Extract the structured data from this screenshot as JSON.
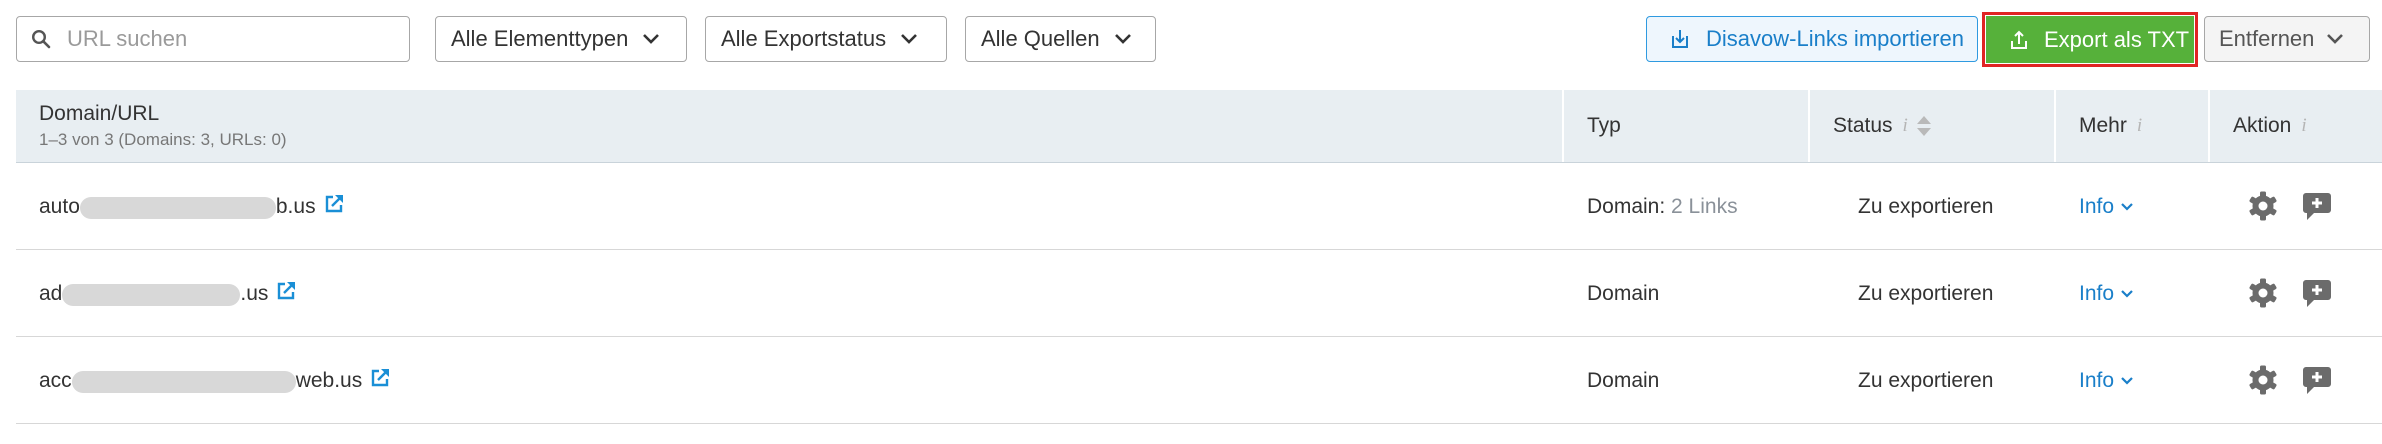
{
  "toolbar": {
    "search": {
      "placeholder": "URL suchen",
      "value": ""
    },
    "filters": [
      {
        "label": "Alle Elementtypen"
      },
      {
        "label": "Alle Exportstatus"
      },
      {
        "label": "Alle Quellen"
      }
    ],
    "import_label": "Disavow-Links importieren",
    "export_label": "Export als TXT",
    "remove_label": "Entfernen"
  },
  "table": {
    "headers": {
      "domain": "Domain/URL",
      "domain_sub": "1–3 von 3 (Domains: 3, URLs: 0)",
      "type": "Typ",
      "status": "Status",
      "more": "Mehr",
      "action": "Aktion",
      "info_glyph": "i"
    },
    "rows": [
      {
        "domain_start": "auto",
        "domain_end": "b.us",
        "type": "Domain:",
        "type_extra": "2 Links",
        "status": "Zu exportieren",
        "more": "Info"
      },
      {
        "domain_start": "ad",
        "domain_end": ".us",
        "type": "Domain",
        "type_extra": "",
        "status": "Zu exportieren",
        "more": "Info"
      },
      {
        "domain_start": "acc",
        "domain_end": "web.us",
        "type": "Domain",
        "type_extra": "",
        "status": "Zu exportieren",
        "more": "Info"
      }
    ]
  },
  "colors": {
    "accent_blue": "#1a7fc9",
    "export_green": "#56b13a",
    "highlight_red": "#e02424",
    "header_bg": "#e8eef2"
  },
  "icons": [
    "search-icon",
    "chevron-down-icon",
    "import-icon",
    "export-upload-icon",
    "external-link-icon",
    "info-icon",
    "sort-icon",
    "gear-icon",
    "comment-plus-icon"
  ]
}
